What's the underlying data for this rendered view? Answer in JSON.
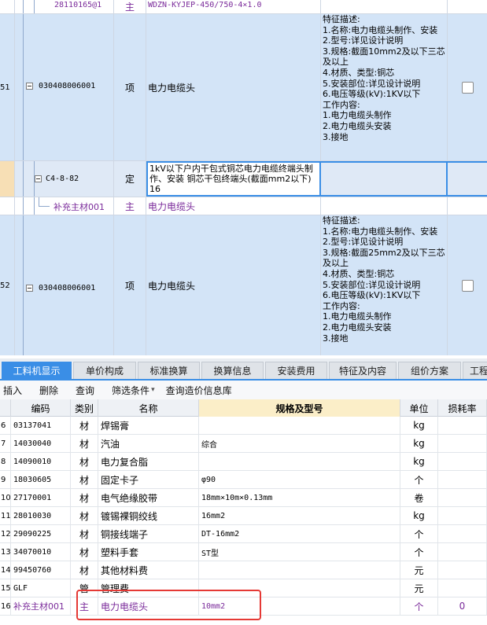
{
  "top_table": {
    "row_partial": {
      "code": "28110165@1",
      "type": "主",
      "name": "WDZN-KYJEP-450/750-4×1.0"
    },
    "row_51": {
      "num": "51",
      "code": "030408006001",
      "type": "项",
      "name": "电力电缆头",
      "features": "特征描述:\n1.名称:电力电缆头制作、安装\n2.型号:详见设计说明\n3.规格:截面10mm2及以下三芯及以上\n4.材质、类型:铜芯\n5.安装部位:详见设计说明\n6.电压等级(kV):1KV以下\n工作内容:\n1.电力电缆头制作\n2.电力电缆头安装\n3.接地"
    },
    "row_sub": {
      "code": "C4-8-82",
      "type": "定",
      "name": "1kV以下户内干包式铜芯电力电缆终端头制作、安装 铜芯干包终端头(截面mm2以下) 16"
    },
    "row_main_mat": {
      "code": "补充主材001",
      "type": "主",
      "name": "电力电缆头"
    },
    "row_52": {
      "num": "52",
      "code": "030408006001",
      "type": "项",
      "name": "电力电缆头",
      "features": "特征描述:\n1.名称:电力电缆头制作、安装\n2.型号:详见设计说明\n3.规格:截面25mm2及以下三芯及以上\n4.材质、类型:铜芯\n5.安装部位:详见设计说明\n6.电压等级(kV):1KV以下\n工作内容:\n1.电力电缆头制作\n2.电力电缆头安装\n3.接地"
    }
  },
  "tabs": [
    "工料机显示",
    "单价构成",
    "标准换算",
    "换算信息",
    "安装费用",
    "特征及内容",
    "组价方案",
    "工程"
  ],
  "toolbar": {
    "insert": "插入",
    "delete": "删除",
    "query": "查询",
    "filter": "筛选条件",
    "filter_arrow": "▾",
    "query_price": "查询造价信息库"
  },
  "grid": {
    "headers": {
      "num": "",
      "code": "编码",
      "category": "类别",
      "name": "名称",
      "spec": "规格及型号",
      "unit": "单位",
      "loss": "损耗率"
    },
    "rows": [
      {
        "num": "6",
        "code": "03137041",
        "category": "材",
        "name": "焊锡膏",
        "spec": "",
        "unit": "kg",
        "loss": ""
      },
      {
        "num": "7",
        "code": "14030040",
        "category": "材",
        "name": "汽油",
        "spec": "综合",
        "unit": "kg",
        "loss": ""
      },
      {
        "num": "8",
        "code": "14090010",
        "category": "材",
        "name": "电力复合脂",
        "spec": "",
        "unit": "kg",
        "loss": ""
      },
      {
        "num": "9",
        "code": "18030605",
        "category": "材",
        "name": "固定卡子",
        "spec": "φ90",
        "unit": "个",
        "loss": ""
      },
      {
        "num": "10",
        "code": "27170001",
        "category": "材",
        "name": "电气绝缘胶带",
        "spec": "18mm×10m×0.13mm",
        "unit": "卷",
        "loss": ""
      },
      {
        "num": "11",
        "code": "28010030",
        "category": "材",
        "name": "镀锡裸铜绞线",
        "spec": "16mm2",
        "unit": "kg",
        "loss": ""
      },
      {
        "num": "12",
        "code": "29090225",
        "category": "材",
        "name": "铜接线端子",
        "spec": "DT-16mm2",
        "unit": "个",
        "loss": ""
      },
      {
        "num": "13",
        "code": "34070010",
        "category": "材",
        "name": "塑料手套",
        "spec": "ST型",
        "unit": "个",
        "loss": ""
      },
      {
        "num": "14",
        "code": "99450760",
        "category": "材",
        "name": "其他材料费",
        "spec": "",
        "unit": "元",
        "loss": ""
      },
      {
        "num": "15",
        "code": "GLF",
        "category": "管",
        "name": "管理费",
        "spec": "",
        "unit": "元",
        "loss": ""
      },
      {
        "num": "16",
        "code": "补充主材001",
        "category": "主",
        "name": "电力电缆头",
        "spec": "10mm2",
        "unit": "个",
        "loss": "0"
      }
    ]
  },
  "colors": {
    "accent": "#3a8ee6",
    "selected_row": "#d3e4f7",
    "main_material": "#7a2a9a",
    "highlight_box": "#e53935"
  }
}
